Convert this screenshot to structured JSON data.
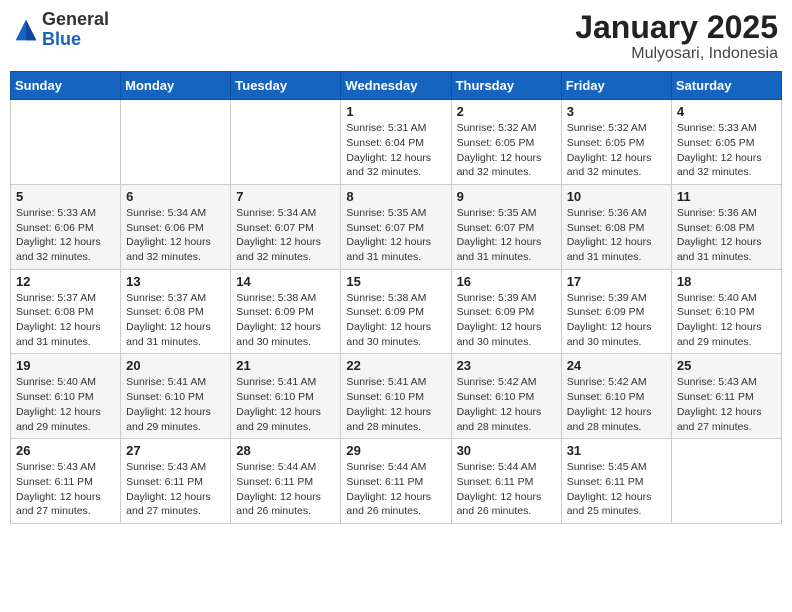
{
  "header": {
    "logo": {
      "general": "General",
      "blue": "Blue"
    },
    "title": "January 2025",
    "location": "Mulyosari, Indonesia"
  },
  "weekdays": [
    "Sunday",
    "Monday",
    "Tuesday",
    "Wednesday",
    "Thursday",
    "Friday",
    "Saturday"
  ],
  "weeks": [
    [
      {
        "day": "",
        "sunrise": "",
        "sunset": "",
        "daylight": ""
      },
      {
        "day": "",
        "sunrise": "",
        "sunset": "",
        "daylight": ""
      },
      {
        "day": "",
        "sunrise": "",
        "sunset": "",
        "daylight": ""
      },
      {
        "day": "1",
        "sunrise": "Sunrise: 5:31 AM",
        "sunset": "Sunset: 6:04 PM",
        "daylight": "Daylight: 12 hours and 32 minutes."
      },
      {
        "day": "2",
        "sunrise": "Sunrise: 5:32 AM",
        "sunset": "Sunset: 6:05 PM",
        "daylight": "Daylight: 12 hours and 32 minutes."
      },
      {
        "day": "3",
        "sunrise": "Sunrise: 5:32 AM",
        "sunset": "Sunset: 6:05 PM",
        "daylight": "Daylight: 12 hours and 32 minutes."
      },
      {
        "day": "4",
        "sunrise": "Sunrise: 5:33 AM",
        "sunset": "Sunset: 6:05 PM",
        "daylight": "Daylight: 12 hours and 32 minutes."
      }
    ],
    [
      {
        "day": "5",
        "sunrise": "Sunrise: 5:33 AM",
        "sunset": "Sunset: 6:06 PM",
        "daylight": "Daylight: 12 hours and 32 minutes."
      },
      {
        "day": "6",
        "sunrise": "Sunrise: 5:34 AM",
        "sunset": "Sunset: 6:06 PM",
        "daylight": "Daylight: 12 hours and 32 minutes."
      },
      {
        "day": "7",
        "sunrise": "Sunrise: 5:34 AM",
        "sunset": "Sunset: 6:07 PM",
        "daylight": "Daylight: 12 hours and 32 minutes."
      },
      {
        "day": "8",
        "sunrise": "Sunrise: 5:35 AM",
        "sunset": "Sunset: 6:07 PM",
        "daylight": "Daylight: 12 hours and 31 minutes."
      },
      {
        "day": "9",
        "sunrise": "Sunrise: 5:35 AM",
        "sunset": "Sunset: 6:07 PM",
        "daylight": "Daylight: 12 hours and 31 minutes."
      },
      {
        "day": "10",
        "sunrise": "Sunrise: 5:36 AM",
        "sunset": "Sunset: 6:08 PM",
        "daylight": "Daylight: 12 hours and 31 minutes."
      },
      {
        "day": "11",
        "sunrise": "Sunrise: 5:36 AM",
        "sunset": "Sunset: 6:08 PM",
        "daylight": "Daylight: 12 hours and 31 minutes."
      }
    ],
    [
      {
        "day": "12",
        "sunrise": "Sunrise: 5:37 AM",
        "sunset": "Sunset: 6:08 PM",
        "daylight": "Daylight: 12 hours and 31 minutes."
      },
      {
        "day": "13",
        "sunrise": "Sunrise: 5:37 AM",
        "sunset": "Sunset: 6:08 PM",
        "daylight": "Daylight: 12 hours and 31 minutes."
      },
      {
        "day": "14",
        "sunrise": "Sunrise: 5:38 AM",
        "sunset": "Sunset: 6:09 PM",
        "daylight": "Daylight: 12 hours and 30 minutes."
      },
      {
        "day": "15",
        "sunrise": "Sunrise: 5:38 AM",
        "sunset": "Sunset: 6:09 PM",
        "daylight": "Daylight: 12 hours and 30 minutes."
      },
      {
        "day": "16",
        "sunrise": "Sunrise: 5:39 AM",
        "sunset": "Sunset: 6:09 PM",
        "daylight": "Daylight: 12 hours and 30 minutes."
      },
      {
        "day": "17",
        "sunrise": "Sunrise: 5:39 AM",
        "sunset": "Sunset: 6:09 PM",
        "daylight": "Daylight: 12 hours and 30 minutes."
      },
      {
        "day": "18",
        "sunrise": "Sunrise: 5:40 AM",
        "sunset": "Sunset: 6:10 PM",
        "daylight": "Daylight: 12 hours and 29 minutes."
      }
    ],
    [
      {
        "day": "19",
        "sunrise": "Sunrise: 5:40 AM",
        "sunset": "Sunset: 6:10 PM",
        "daylight": "Daylight: 12 hours and 29 minutes."
      },
      {
        "day": "20",
        "sunrise": "Sunrise: 5:41 AM",
        "sunset": "Sunset: 6:10 PM",
        "daylight": "Daylight: 12 hours and 29 minutes."
      },
      {
        "day": "21",
        "sunrise": "Sunrise: 5:41 AM",
        "sunset": "Sunset: 6:10 PM",
        "daylight": "Daylight: 12 hours and 29 minutes."
      },
      {
        "day": "22",
        "sunrise": "Sunrise: 5:41 AM",
        "sunset": "Sunset: 6:10 PM",
        "daylight": "Daylight: 12 hours and 28 minutes."
      },
      {
        "day": "23",
        "sunrise": "Sunrise: 5:42 AM",
        "sunset": "Sunset: 6:10 PM",
        "daylight": "Daylight: 12 hours and 28 minutes."
      },
      {
        "day": "24",
        "sunrise": "Sunrise: 5:42 AM",
        "sunset": "Sunset: 6:10 PM",
        "daylight": "Daylight: 12 hours and 28 minutes."
      },
      {
        "day": "25",
        "sunrise": "Sunrise: 5:43 AM",
        "sunset": "Sunset: 6:11 PM",
        "daylight": "Daylight: 12 hours and 27 minutes."
      }
    ],
    [
      {
        "day": "26",
        "sunrise": "Sunrise: 5:43 AM",
        "sunset": "Sunset: 6:11 PM",
        "daylight": "Daylight: 12 hours and 27 minutes."
      },
      {
        "day": "27",
        "sunrise": "Sunrise: 5:43 AM",
        "sunset": "Sunset: 6:11 PM",
        "daylight": "Daylight: 12 hours and 27 minutes."
      },
      {
        "day": "28",
        "sunrise": "Sunrise: 5:44 AM",
        "sunset": "Sunset: 6:11 PM",
        "daylight": "Daylight: 12 hours and 26 minutes."
      },
      {
        "day": "29",
        "sunrise": "Sunrise: 5:44 AM",
        "sunset": "Sunset: 6:11 PM",
        "daylight": "Daylight: 12 hours and 26 minutes."
      },
      {
        "day": "30",
        "sunrise": "Sunrise: 5:44 AM",
        "sunset": "Sunset: 6:11 PM",
        "daylight": "Daylight: 12 hours and 26 minutes."
      },
      {
        "day": "31",
        "sunrise": "Sunrise: 5:45 AM",
        "sunset": "Sunset: 6:11 PM",
        "daylight": "Daylight: 12 hours and 25 minutes."
      },
      {
        "day": "",
        "sunrise": "",
        "sunset": "",
        "daylight": ""
      }
    ]
  ]
}
